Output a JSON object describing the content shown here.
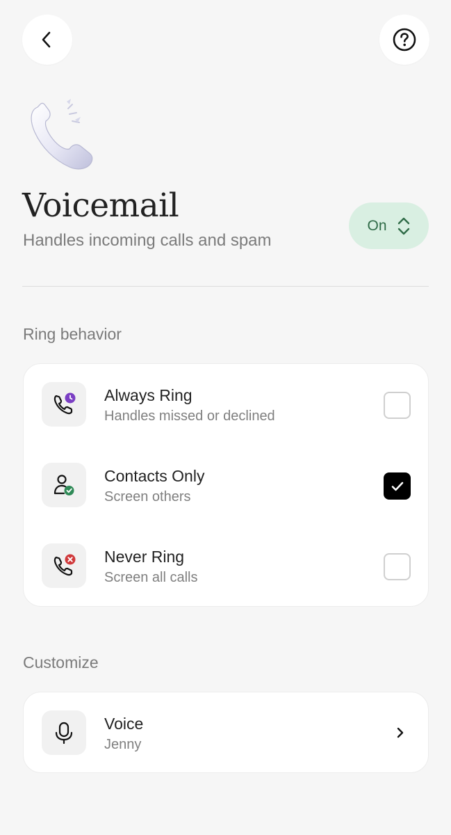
{
  "header": {
    "back_icon": "chevron-left-icon",
    "help_icon": "question-circle-icon"
  },
  "hero": {
    "icon": "phone-handset-icon",
    "title": "Voicemail",
    "subtitle": "Handles incoming calls and spam",
    "toggle_label": "On",
    "toggle_color": "#d9efe2"
  },
  "ring_behavior": {
    "section_title": "Ring behavior",
    "options": [
      {
        "title": "Always Ring",
        "subtitle": "Handles missed or declined",
        "icon": "phone-clock-icon",
        "badge_color": "#7b3fc4",
        "checked": false
      },
      {
        "title": "Contacts Only",
        "subtitle": "Screen others",
        "icon": "person-check-icon",
        "badge_color": "#2f8a57",
        "checked": true
      },
      {
        "title": "Never Ring",
        "subtitle": "Screen all calls",
        "icon": "phone-x-icon",
        "badge_color": "#d0393b",
        "checked": false
      }
    ]
  },
  "customize": {
    "section_title": "Customize",
    "voice": {
      "title": "Voice",
      "subtitle": "Jenny",
      "icon": "microphone-icon"
    }
  }
}
